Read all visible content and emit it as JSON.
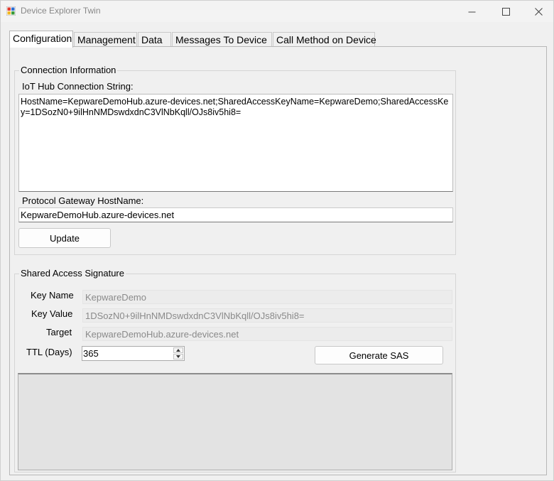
{
  "window": {
    "title": "Device Explorer Twin",
    "controls": {
      "minimize": "─",
      "maximize": "☐",
      "close": "✕"
    }
  },
  "tabs": [
    {
      "label": "Configuration",
      "active": true
    },
    {
      "label": "Management",
      "active": false
    },
    {
      "label": "Data",
      "active": false
    },
    {
      "label": "Messages To Device",
      "active": false
    },
    {
      "label": "Call Method on Device",
      "active": false
    }
  ],
  "connection": {
    "group_title": "Connection Information",
    "conn_string_label": "IoT Hub Connection String:",
    "conn_string_value": "HostName=KepwareDemoHub.azure-devices.net;SharedAccessKeyName=KepwareDemo;SharedAccessKey=1DSozN0+9ilHnNMDswdxdnC3VlNbKqll/OJs8iv5hi8=",
    "gateway_label": "Protocol Gateway HostName:",
    "gateway_value": "KepwareDemoHub.azure-devices.net",
    "update_label": "Update"
  },
  "sas": {
    "group_title": "Shared Access Signature",
    "key_name_label": "Key Name",
    "key_name_value": "KepwareDemo",
    "key_value_label": "Key Value",
    "key_value_value": "1DSozN0+9ilHnNMDswdxdnC3VlNbKqll/OJs8iv5hi8=",
    "target_label": "Target",
    "target_value": "KepwareDemoHub.azure-devices.net",
    "ttl_label": "TTL (Days)",
    "ttl_value": "365",
    "generate_label": "Generate SAS",
    "output_value": ""
  }
}
